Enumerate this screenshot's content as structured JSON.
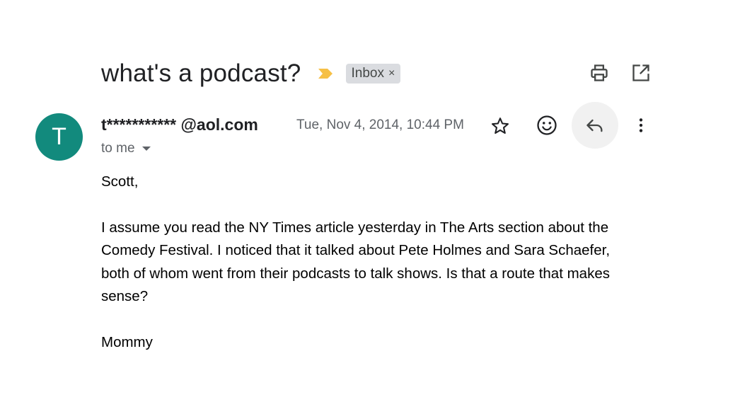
{
  "email": {
    "subject": "what's a podcast?",
    "label": "Inbox",
    "label_remove": "×",
    "avatar_letter": "T",
    "sender": "t*********** @aol.com",
    "recipient": "to me",
    "date": "Tue, Nov 4, 2014, 10:44 PM",
    "body": {
      "greeting": "Scott,",
      "paragraph": "I assume you read the NY Times article yesterday in The Arts section about the\nComedy Festival.  I noticed that it talked about Pete Holmes and Sara Schaefer,\nboth of whom went from their podcasts to talk shows.  Is that a route that makes\nsense?",
      "signature": "Mommy"
    }
  },
  "colors": {
    "avatar": "#128a7d",
    "importance_marker": "#f6c046",
    "label_chip": "#dadce0",
    "reply_hover": "#f1f1f1"
  },
  "icons": {
    "importance": "importance-marker-icon",
    "print": "print-icon",
    "open_new_window": "open-in-new-window-icon",
    "star": "star-icon",
    "emoji": "emoji-reaction-icon",
    "reply": "reply-icon",
    "more": "more-vertical-icon",
    "dropdown": "chevron-down-icon"
  }
}
